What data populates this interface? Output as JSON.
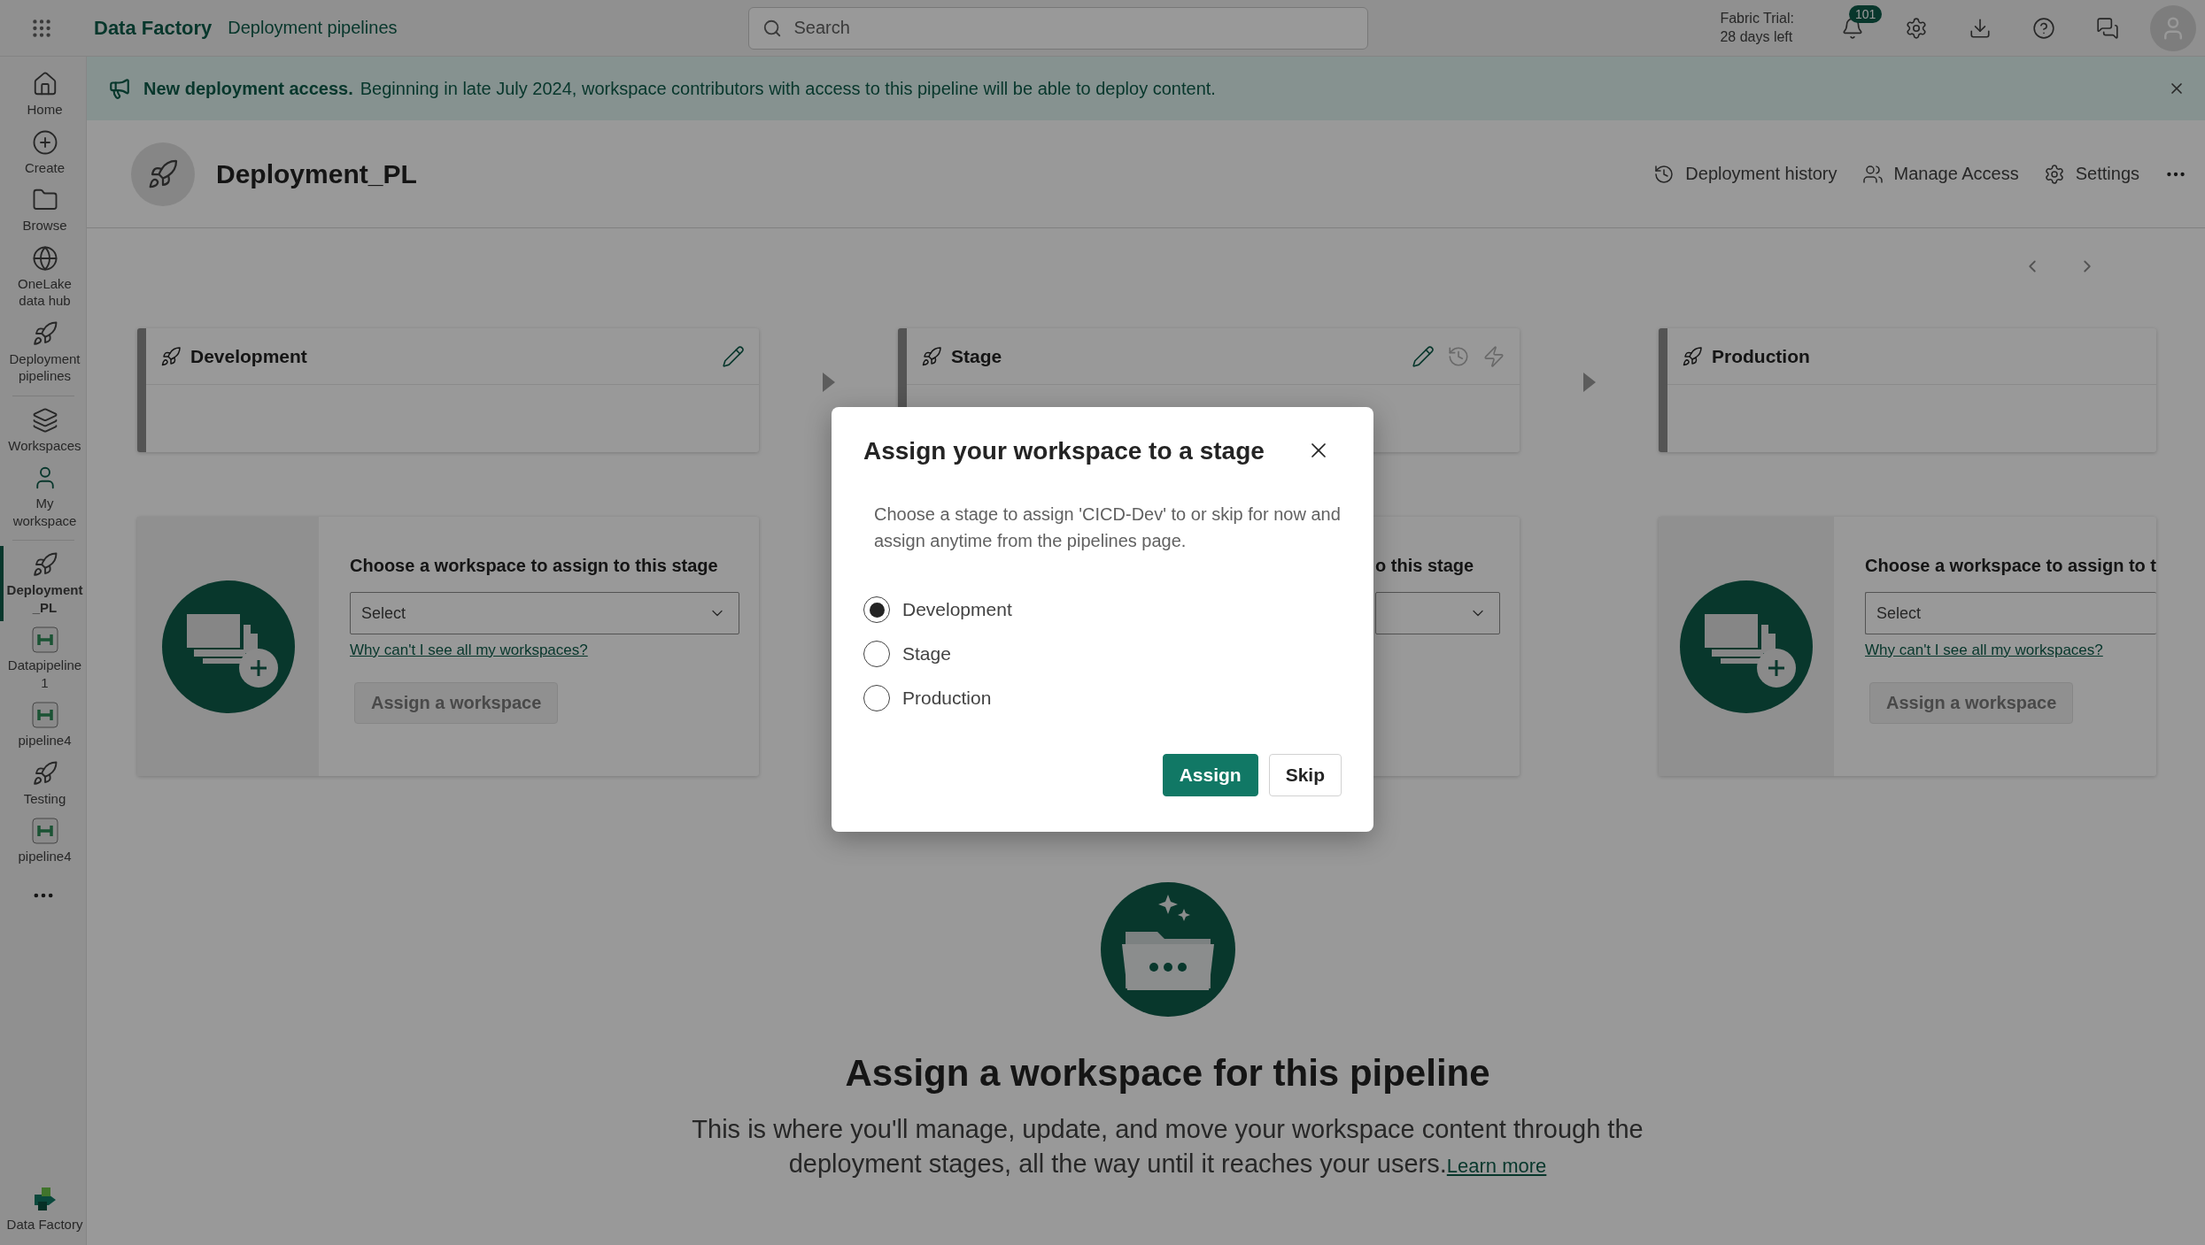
{
  "app_bar": {
    "app_name": "Data Factory",
    "section": "Deployment pipelines",
    "search": {
      "placeholder": "Search"
    },
    "trial_label": "Fabric Trial:",
    "trial_days": "28 days left",
    "notification_count": "101"
  },
  "sidebar": {
    "groups": [
      {
        "items": [
          {
            "label": "Home",
            "kind": "home",
            "selected": false
          },
          {
            "label": "Create",
            "kind": "create",
            "selected": false
          },
          {
            "label": "Browse",
            "kind": "browse",
            "selected": false
          },
          {
            "label": "OneLake data hub",
            "kind": "onelake",
            "selected": false
          },
          {
            "label": "Deployment pipelines",
            "kind": "rocket",
            "selected": false
          }
        ]
      },
      {
        "items": [
          {
            "label": "Workspaces",
            "kind": "workspaces",
            "selected": false
          },
          {
            "label": "My workspace",
            "kind": "person",
            "selected": false
          }
        ]
      },
      {
        "items": [
          {
            "label": "Deployment _PL",
            "kind": "rocket",
            "selected": true
          },
          {
            "label": "Datapipeline 1",
            "kind": "pipeline",
            "selected": false
          },
          {
            "label": "pipeline4",
            "kind": "pipeline",
            "selected": false
          },
          {
            "label": "Testing",
            "kind": "rocket",
            "selected": false
          },
          {
            "label": "pipeline4",
            "kind": "pipeline",
            "selected": false
          }
        ]
      }
    ],
    "footer": {
      "label": "Data Factory"
    }
  },
  "banner": {
    "title": "New deployment access.",
    "message": "Beginning in late July 2024, workspace contributors with access to this pipeline will be able to deploy content."
  },
  "pipeline": {
    "name": "Deployment_PL",
    "actions": [
      {
        "label": "Deployment history",
        "kind": "history"
      },
      {
        "label": "Manage Access",
        "kind": "people"
      },
      {
        "label": "Settings",
        "kind": "settings"
      }
    ]
  },
  "stages": [
    {
      "name": "Development",
      "tools": [
        {
          "kind": "edit"
        }
      ],
      "assign": {
        "kind": "full",
        "heading": "Choose a workspace to assign to this stage",
        "select_placeholder": "Select",
        "help_link": "Why can't I see all my workspaces?",
        "button": "Assign a workspace",
        "button_disabled": true
      }
    },
    {
      "name": "Stage",
      "tools": [
        {
          "kind": "edit"
        },
        {
          "kind": "history"
        },
        {
          "kind": "deploy-settings"
        }
      ],
      "assign": {
        "kind": "covered",
        "heading": "o this stage"
      }
    },
    {
      "name": "Production",
      "assign": {
        "kind": "full",
        "heading": "Choose a workspace to assign to t",
        "select_placeholder": "Select",
        "help_link": "Why can't I see all my workspaces?",
        "button": "Assign a workspace",
        "button_disabled": true
      }
    }
  ],
  "empty_state": {
    "title": "Assign a workspace for this pipeline",
    "description": "This is where you'll manage, update, and move your workspace content through the deployment stages, all the way until it reaches your users.",
    "link": "Learn more"
  },
  "dialog": {
    "title": "Assign your workspace to a stage",
    "description": "Choose a stage to assign 'CICD-Dev' to or skip for now and assign anytime from the pipelines page.",
    "options": [
      {
        "label": "Development",
        "selected": true
      },
      {
        "label": "Stage",
        "selected": false
      },
      {
        "label": "Production",
        "selected": false
      }
    ],
    "buttons": [
      {
        "label": "Assign",
        "kind": "primary"
      },
      {
        "label": "Skip",
        "kind": "secondary"
      }
    ]
  }
}
